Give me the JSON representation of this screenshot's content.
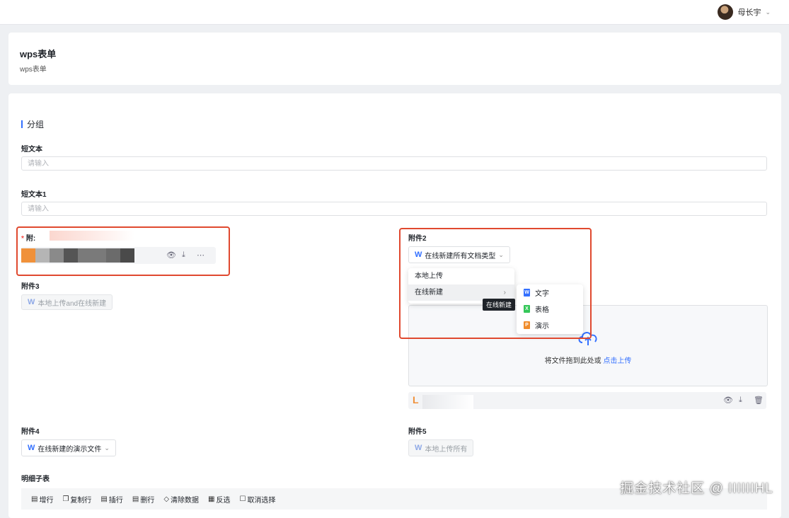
{
  "user": {
    "name": "母长宇",
    "chevron_icon": "chevron-down-icon"
  },
  "header": {
    "title": "wps表单",
    "subtitle": "wps表单"
  },
  "form": {
    "group_title": "分组",
    "short_text": {
      "label": "短文本",
      "placeholder": "请输入"
    },
    "short_text1": {
      "label": "短文本1",
      "placeholder": "请输入"
    },
    "attachment1": {
      "label": "附:",
      "required": "*"
    },
    "attachment2": {
      "label": "附件2",
      "button_label": "在线新建所有文档类型",
      "menu": {
        "items": [
          "本地上传",
          "在线新建"
        ]
      },
      "submenu": {
        "items": [
          "文字",
          "表格",
          "演示"
        ],
        "colors": [
          "#3370ff",
          "#34c759",
          "#f08c2b"
        ],
        "letters": [
          "W",
          "X",
          "P"
        ]
      },
      "tooltip": "在线新建",
      "drop_text": "将文件拖到此处或",
      "drop_link": "点击上传",
      "file_prefix": "L"
    },
    "attachment3": {
      "label": "附件3",
      "button_label": "本地上传and在线新建"
    },
    "attachment4": {
      "label": "附件4",
      "button_label": "在线新建的演示文件"
    },
    "attachment5": {
      "label": "附件5",
      "button_label": "本地上传所有"
    },
    "detail_table": {
      "label": "明细子表",
      "toolbar": [
        "增行",
        "复制行",
        "插行",
        "删行",
        "清除数据",
        "反选",
        "取消选择"
      ]
    }
  },
  "watermark": "掘金技术社区 @ IIIIIIHL",
  "colors": {
    "accent": "#3370ff",
    "highlight_border": "#e0492f",
    "danger": "#f54a45"
  }
}
